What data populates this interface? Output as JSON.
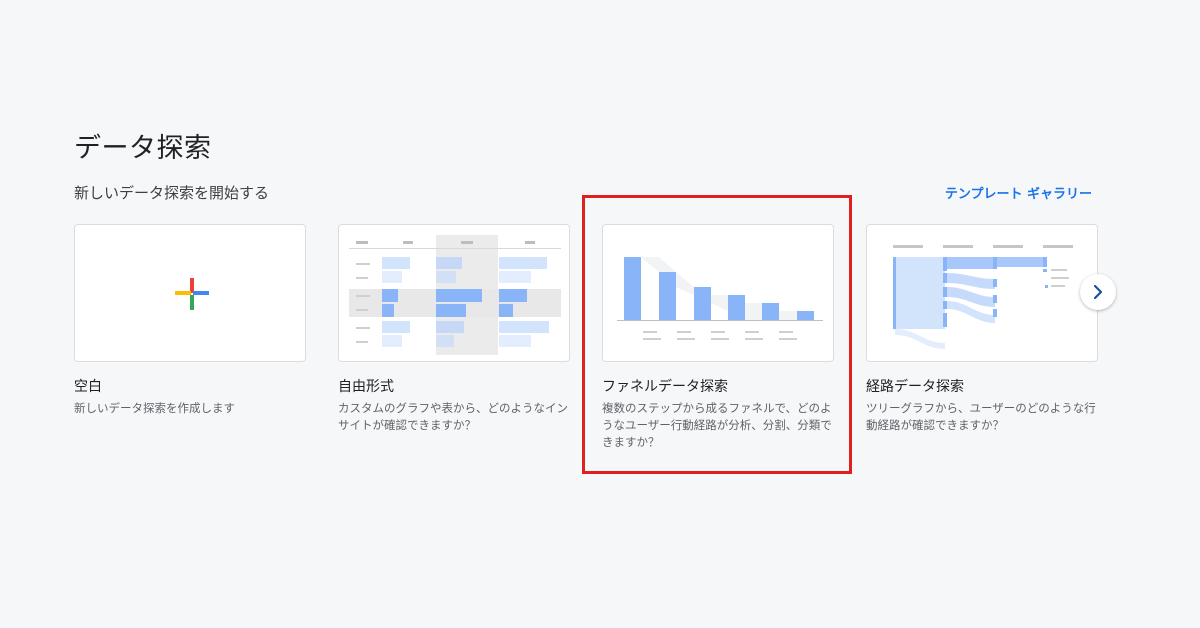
{
  "page": {
    "title": "データ探索"
  },
  "section": {
    "subtitle": "新しいデータ探索を開始する",
    "gallery_link": "テンプレート ギャラリー"
  },
  "cards": [
    {
      "title": "空白",
      "description": "新しいデータ探索を作成します",
      "thumbnail_icon": "plus-icon"
    },
    {
      "title": "自由形式",
      "description": "カスタムのグラフや表から、どのようなインサイトが確認できますか？",
      "thumbnail_icon": "table-icon"
    },
    {
      "title": "ファネルデータ探索",
      "description": "複数のステップから成るファネルで、どのようなユーザー行動経路が分析、分割、分類できますか？",
      "thumbnail_icon": "funnel-icon"
    },
    {
      "title": "経路データ探索",
      "description": "ツリーグラフから、ユーザーのどのような行動経路が確認できますか？",
      "thumbnail_icon": "path-icon"
    }
  ],
  "carousel": {
    "next_icon": "chevron-right-icon"
  },
  "colors": {
    "accent": "#1a73e8",
    "highlight_border": "#e0201c",
    "chart_blue": "#8ab4f8"
  }
}
